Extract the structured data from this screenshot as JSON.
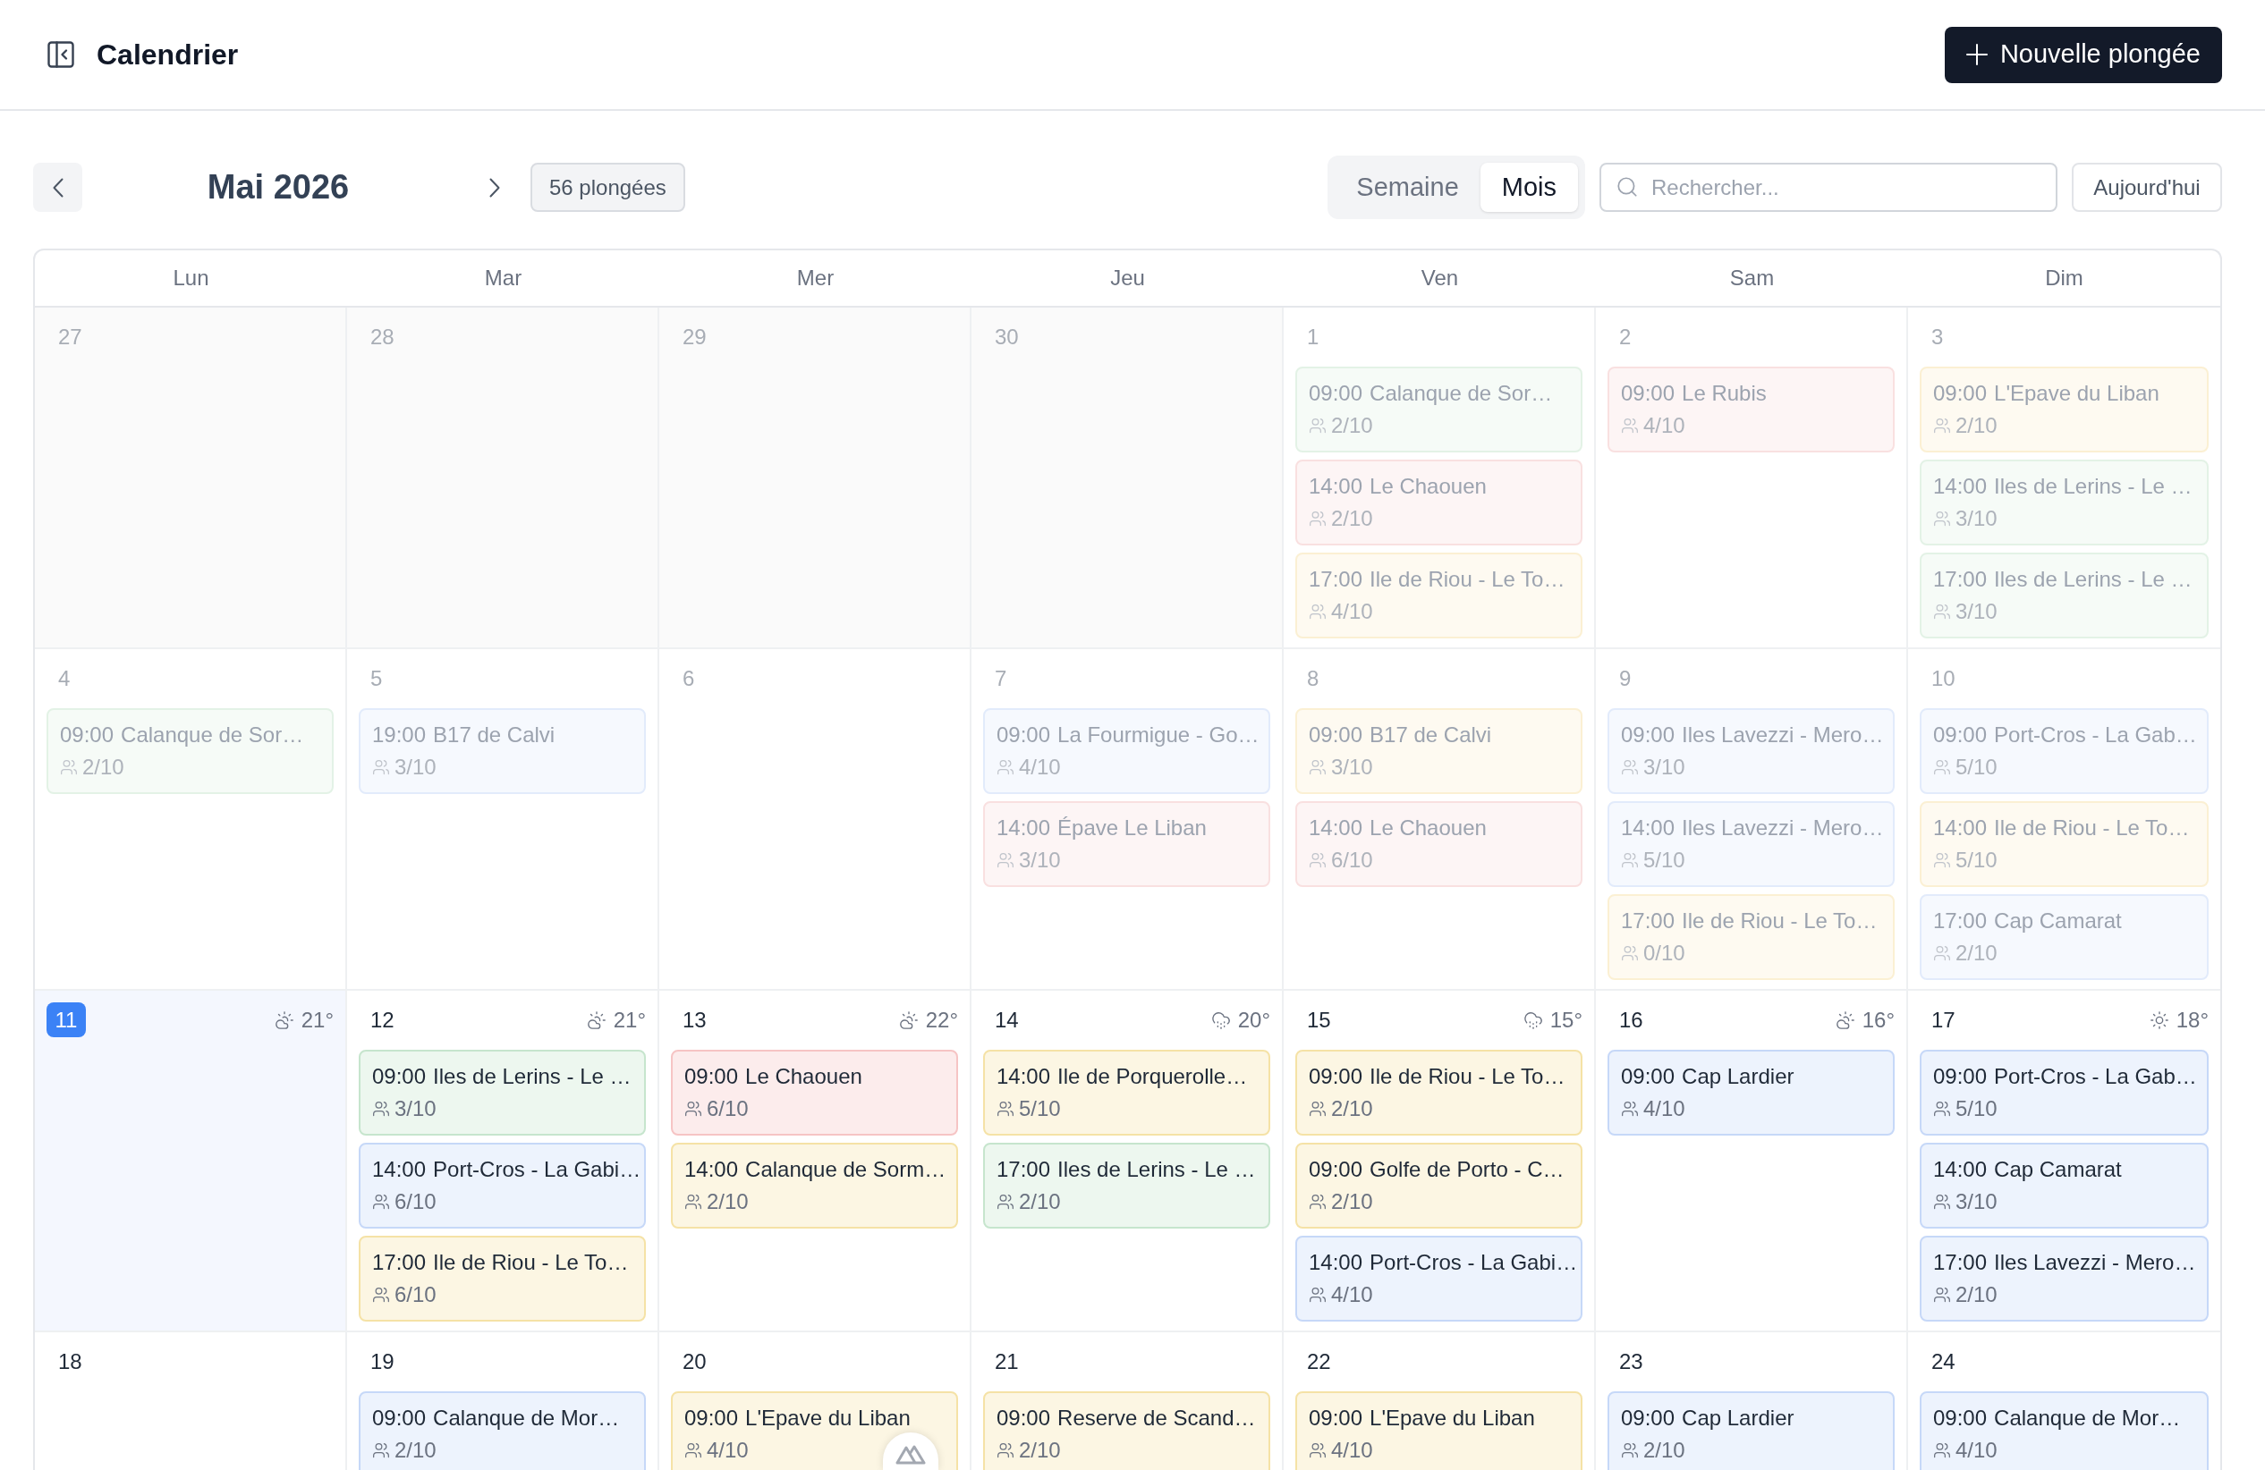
{
  "header": {
    "title": "Calendrier",
    "new_button": "Nouvelle plongée"
  },
  "toolbar": {
    "month": "Mai 2026",
    "count_badge": "56 plongées",
    "views": [
      {
        "label": "Semaine",
        "selected": false
      },
      {
        "label": "Mois",
        "selected": true
      }
    ],
    "search": {
      "placeholder": "Rechercher..."
    },
    "today_button": "Aujourd'hui"
  },
  "calendar": {
    "weekdays": [
      "Lun",
      "Mar",
      "Mer",
      "Jeu",
      "Ven",
      "Sam",
      "Dim"
    ],
    "weeks": [
      {
        "days": [
          {
            "day": "27",
            "kind": "outside-month"
          },
          {
            "day": "28",
            "kind": "outside-month"
          },
          {
            "day": "29",
            "kind": "outside-month"
          },
          {
            "day": "30",
            "kind": "outside-month"
          },
          {
            "day": "1",
            "kind": "past",
            "events": [
              {
                "time": "09:00",
                "title": "Calanque de Sor…",
                "count": "2/10",
                "color": "#e3f2e6"
              },
              {
                "time": "14:00",
                "title": "Le Chaouen",
                "count": "2/10",
                "color": "#f9e0e0"
              },
              {
                "time": "17:00",
                "title": "Ile de Riou - Le To…",
                "count": "4/10",
                "color": "#fbf0d3"
              }
            ]
          },
          {
            "day": "2",
            "kind": "past",
            "events": [
              {
                "time": "09:00",
                "title": "Le Rubis",
                "count": "4/10",
                "color": "#f9e0e0"
              }
            ]
          },
          {
            "day": "3",
            "kind": "past",
            "events": [
              {
                "time": "09:00",
                "title": "L'Epave du Liban",
                "count": "2/10",
                "color": "#fbf0d3"
              },
              {
                "time": "14:00",
                "title": "Iles de Lerins - Le …",
                "count": "3/10",
                "color": "#e3f2e6"
              },
              {
                "time": "17:00",
                "title": "Iles de Lerins - Le …",
                "count": "3/10",
                "color": "#e3f2e6"
              }
            ]
          }
        ]
      },
      {
        "days": [
          {
            "day": "4",
            "kind": "past",
            "events": [
              {
                "time": "09:00",
                "title": "Calanque de Sor…",
                "count": "2/10",
                "color": "#e3f2e6"
              }
            ]
          },
          {
            "day": "5",
            "kind": "past",
            "events": [
              {
                "time": "19:00",
                "title": "B17 de Calvi",
                "count": "3/10",
                "color": "#e2ebfb"
              }
            ]
          },
          {
            "day": "6",
            "kind": "past"
          },
          {
            "day": "7",
            "kind": "past",
            "events": [
              {
                "time": "09:00",
                "title": "La Fourmigue - Go…",
                "count": "4/10",
                "color": "#e2ebfb"
              },
              {
                "time": "14:00",
                "title": "Épave Le Liban",
                "count": "3/10",
                "color": "#f9e0e0"
              }
            ]
          },
          {
            "day": "8",
            "kind": "past",
            "events": [
              {
                "time": "09:00",
                "title": "B17 de Calvi",
                "count": "3/10",
                "color": "#fbf0d3"
              },
              {
                "time": "14:00",
                "title": "Le Chaouen",
                "count": "6/10",
                "color": "#f9e0e0"
              }
            ]
          },
          {
            "day": "9",
            "kind": "past",
            "events": [
              {
                "time": "09:00",
                "title": "Iles Lavezzi - Mero…",
                "count": "3/10",
                "color": "#e2ebfb"
              },
              {
                "time": "14:00",
                "title": "Iles Lavezzi - Mero…",
                "count": "5/10",
                "color": "#e2ebfb"
              },
              {
                "time": "17:00",
                "title": "Ile de Riou - Le To…",
                "count": "0/10",
                "color": "#fbf0d3"
              }
            ]
          },
          {
            "day": "10",
            "kind": "past",
            "events": [
              {
                "time": "09:00",
                "title": "Port-Cros - La Gab…",
                "count": "5/10",
                "color": "#e2ebfb"
              },
              {
                "time": "14:00",
                "title": "Ile de Riou - Le To…",
                "count": "5/10",
                "color": "#fbf0d3"
              },
              {
                "time": "17:00",
                "title": "Cap Camarat",
                "count": "2/10",
                "color": "#e2ebfb"
              }
            ]
          }
        ]
      },
      {
        "days": [
          {
            "day": "11",
            "kind": "today",
            "weather": {
              "kind": "partly-cloudy",
              "temp": "21°"
            }
          },
          {
            "day": "12",
            "kind": "upcoming",
            "weather": {
              "kind": "partly-cloudy",
              "temp": "21°"
            },
            "events": [
              {
                "time": "09:00",
                "title": "Iles de Lerins - Le …",
                "count": "3/10",
                "color": "#c6e5cd"
              },
              {
                "time": "14:00",
                "title": "Port-Cros - La Gabi…",
                "count": "6/10",
                "color": "#c6d8f8"
              },
              {
                "time": "17:00",
                "title": "Ile de Riou - Le To…",
                "count": "6/10",
                "color": "#f5e2a6"
              }
            ]
          },
          {
            "day": "13",
            "kind": "upcoming",
            "weather": {
              "kind": "partly-cloudy",
              "temp": "22°"
            },
            "events": [
              {
                "time": "09:00",
                "title": "Le Chaouen",
                "count": "6/10",
                "color": "#f6c4c4"
              },
              {
                "time": "14:00",
                "title": "Calanque de Sorm…",
                "count": "2/10",
                "color": "#f5e2a6"
              }
            ]
          },
          {
            "day": "14",
            "kind": "upcoming",
            "weather": {
              "kind": "rain",
              "temp": "20°"
            },
            "events": [
              {
                "time": "14:00",
                "title": "Ile de Porquerolle…",
                "count": "5/10",
                "color": "#f5e2a6"
              },
              {
                "time": "17:00",
                "title": "Iles de Lerins - Le …",
                "count": "2/10",
                "color": "#c6e5cd"
              }
            ]
          },
          {
            "day": "15",
            "kind": "upcoming",
            "weather": {
              "kind": "rain",
              "temp": "15°"
            },
            "events": [
              {
                "time": "09:00",
                "title": "Ile de Riou - Le To…",
                "count": "2/10",
                "color": "#f5e2a6"
              },
              {
                "time": "09:00",
                "title": "Golfe de Porto - C…",
                "count": "2/10",
                "color": "#f5e2a6"
              },
              {
                "time": "14:00",
                "title": "Port-Cros - La Gabi…",
                "count": "4/10",
                "color": "#c6d8f8"
              }
            ]
          },
          {
            "day": "16",
            "kind": "upcoming",
            "weather": {
              "kind": "partly-cloudy",
              "temp": "16°"
            },
            "events": [
              {
                "time": "09:00",
                "title": "Cap Lardier",
                "count": "4/10",
                "color": "#c6d8f8"
              }
            ]
          },
          {
            "day": "17",
            "kind": "upcoming",
            "weather": {
              "kind": "sun",
              "temp": "18°"
            },
            "events": [
              {
                "time": "09:00",
                "title": "Port-Cros - La Gab…",
                "count": "5/10",
                "color": "#c6d8f8"
              },
              {
                "time": "14:00",
                "title": "Cap Camarat",
                "count": "3/10",
                "color": "#c6d8f8"
              },
              {
                "time": "17:00",
                "title": "Iles Lavezzi - Mero…",
                "count": "2/10",
                "color": "#c6d8f8"
              }
            ]
          }
        ]
      },
      {
        "days": [
          {
            "day": "18",
            "kind": "upcoming"
          },
          {
            "day": "19",
            "kind": "upcoming",
            "events": [
              {
                "time": "09:00",
                "title": "Calanque de Mor…",
                "count": "2/10",
                "color": "#c6d8f8"
              }
            ]
          },
          {
            "day": "20",
            "kind": "upcoming",
            "events": [
              {
                "time": "09:00",
                "title": "L'Epave du Liban",
                "count": "4/10",
                "color": "#f5e2a6"
              }
            ]
          },
          {
            "day": "21",
            "kind": "upcoming",
            "events": [
              {
                "time": "09:00",
                "title": "Reserve de Scand…",
                "count": "2/10",
                "color": "#f5e2a6"
              }
            ]
          },
          {
            "day": "22",
            "kind": "upcoming",
            "events": [
              {
                "time": "09:00",
                "title": "L'Epave du Liban",
                "count": "4/10",
                "color": "#f5e2a6"
              }
            ]
          },
          {
            "day": "23",
            "kind": "upcoming",
            "events": [
              {
                "time": "09:00",
                "title": "Cap Lardier",
                "count": "2/10",
                "color": "#c6d8f8"
              }
            ]
          },
          {
            "day": "24",
            "kind": "upcoming",
            "events": [
              {
                "time": "09:00",
                "title": "Calanque de Mor…",
                "count": "4/10",
                "color": "#c6d8f8"
              }
            ]
          }
        ]
      }
    ]
  }
}
